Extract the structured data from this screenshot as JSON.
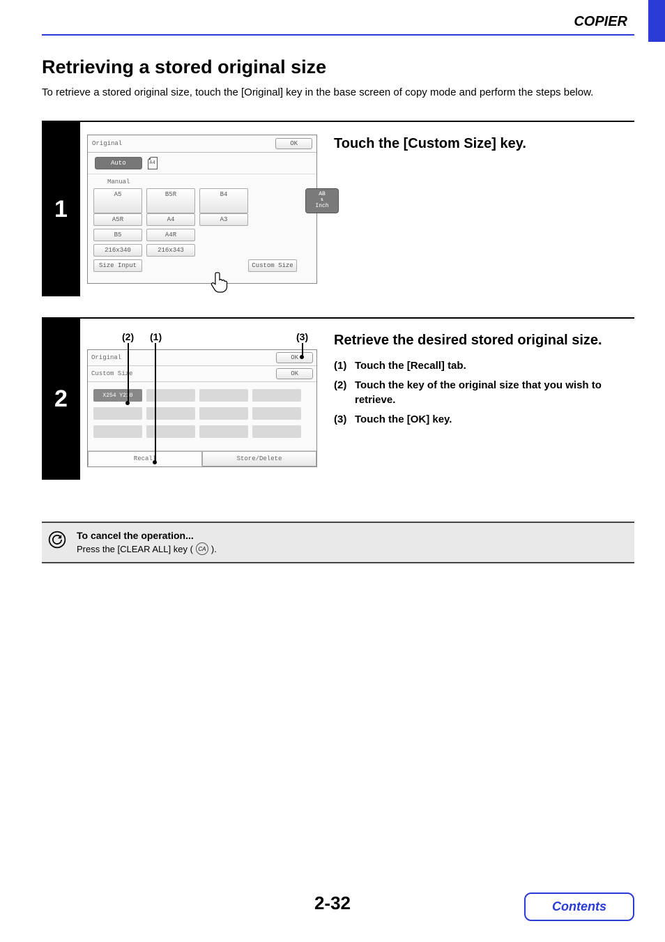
{
  "header": {
    "section": "COPIER"
  },
  "title": "Retrieving a stored original size",
  "intro": "To retrieve a stored original size, touch the [Original] key in the base screen of copy mode and perform the steps below.",
  "step1": {
    "number": "1",
    "heading": "Touch the [Custom Size] key.",
    "panel": {
      "title": "Original",
      "ok": "OK",
      "auto": "Auto",
      "doc_label": "A4",
      "manual": "Manual",
      "ab_top": "AB",
      "ab_bottom": "Inch",
      "buttons": {
        "r1": [
          "A5",
          "B5R",
          "B4"
        ],
        "r2": [
          "A5R",
          "A4",
          "A3"
        ],
        "r3": [
          "B5",
          "A4R"
        ],
        "r4": [
          "216x340",
          "216x343"
        ],
        "size_input": "Size Input",
        "custom_size": "Custom Size"
      }
    }
  },
  "step2": {
    "number": "2",
    "heading": "Retrieve the desired stored original size.",
    "callouts": {
      "c1": "(1)",
      "c2": "(2)",
      "c3": "(3)"
    },
    "substeps": {
      "s1": {
        "num": "(1)",
        "text": "Touch the [Recall] tab."
      },
      "s2": {
        "num": "(2)",
        "text": "Touch the key of the original size that you wish to retrieve."
      },
      "s3": {
        "num": "(3)",
        "text": "Touch the [OK] key."
      }
    },
    "panel": {
      "title": "Original",
      "ok": "OK",
      "subtitle": "Custom Size",
      "ok2": "OK",
      "filled_slot": "X254 Y210",
      "tab_recall": "Recall",
      "tab_store": "Store/Delete"
    }
  },
  "cancel": {
    "title": "To cancel the operation...",
    "body_pre": "Press the [CLEAR ALL] key (",
    "key": "CA",
    "body_post": ")."
  },
  "footer": {
    "page": "2-32",
    "contents": "Contents"
  }
}
